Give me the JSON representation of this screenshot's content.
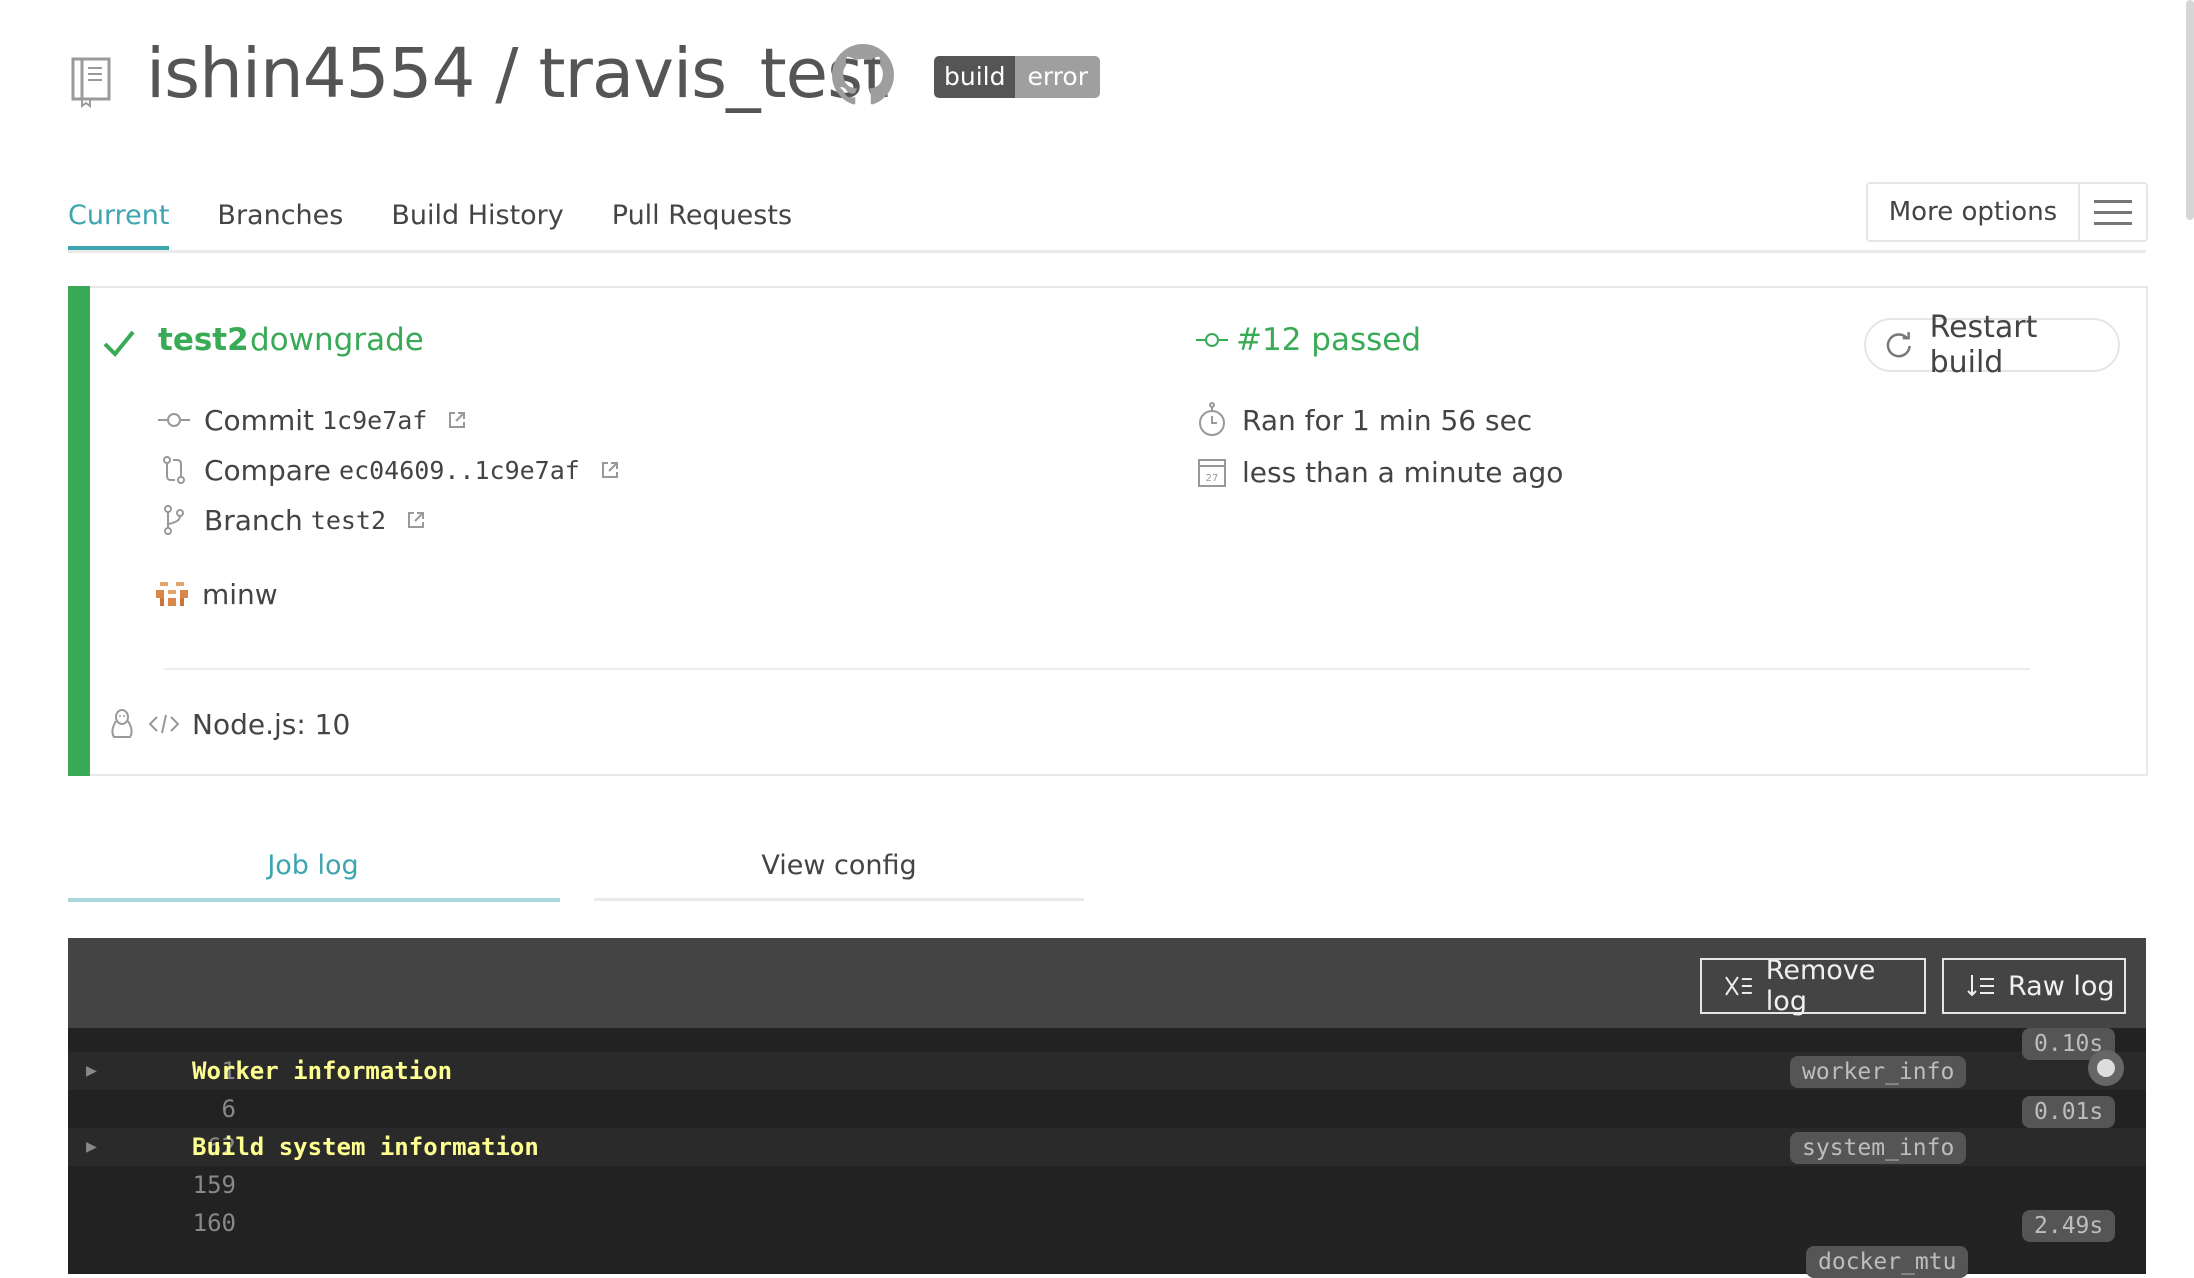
{
  "header": {
    "repo_title": "ishin4554 / travis_test",
    "badge_left": "build",
    "badge_right": "error"
  },
  "tabs": [
    {
      "label": "Current",
      "active": true
    },
    {
      "label": "Branches",
      "active": false
    },
    {
      "label": "Build History",
      "active": false
    },
    {
      "label": "Pull Requests",
      "active": false
    }
  ],
  "more_options_label": "More options",
  "build": {
    "branch": "test2",
    "commit_message": "downgrade",
    "status_text": "#12 passed",
    "restart_label": "Restart build",
    "commit_label": "Commit",
    "commit_sha": "1c9e7af",
    "compare_label": "Compare",
    "compare_range": "ec04609..1c9e7af",
    "branch_label": "Branch",
    "branch_value": "test2",
    "author": "minw",
    "duration": "Ran for 1 min 56 sec",
    "finished": "less than a minute ago",
    "language": "Node.js: 10",
    "status_color": "#39aa56"
  },
  "subtabs": {
    "job_log": "Job log",
    "view_config": "View config"
  },
  "log": {
    "remove_label": "Remove log",
    "raw_label": "Raw log",
    "lines": [
      {
        "num": "1",
        "text": "Worker information",
        "fold": true
      },
      {
        "num": "6",
        "text": "",
        "fold": false
      },
      {
        "num": "62",
        "text": "Build system information",
        "fold": true
      },
      {
        "num": "159",
        "text": "",
        "fold": false
      },
      {
        "num": "160",
        "text": "",
        "fold": false
      }
    ],
    "timings": [
      "0.10s",
      "0.01s",
      "2.49s"
    ],
    "tags": [
      "worker_info",
      "system_info",
      "docker_mtu"
    ]
  },
  "icons": {
    "repo": "repo-book-icon",
    "github": "github-octocat-icon",
    "check": "check-icon",
    "commit": "commit-icon",
    "compare": "compare-icon",
    "branch": "branch-icon",
    "stopwatch": "stopwatch-icon",
    "calendar": "calendar-icon",
    "linux": "linux-tux-icon",
    "code": "code-icon",
    "external_link": "external-link-icon",
    "restart": "restart-icon"
  }
}
